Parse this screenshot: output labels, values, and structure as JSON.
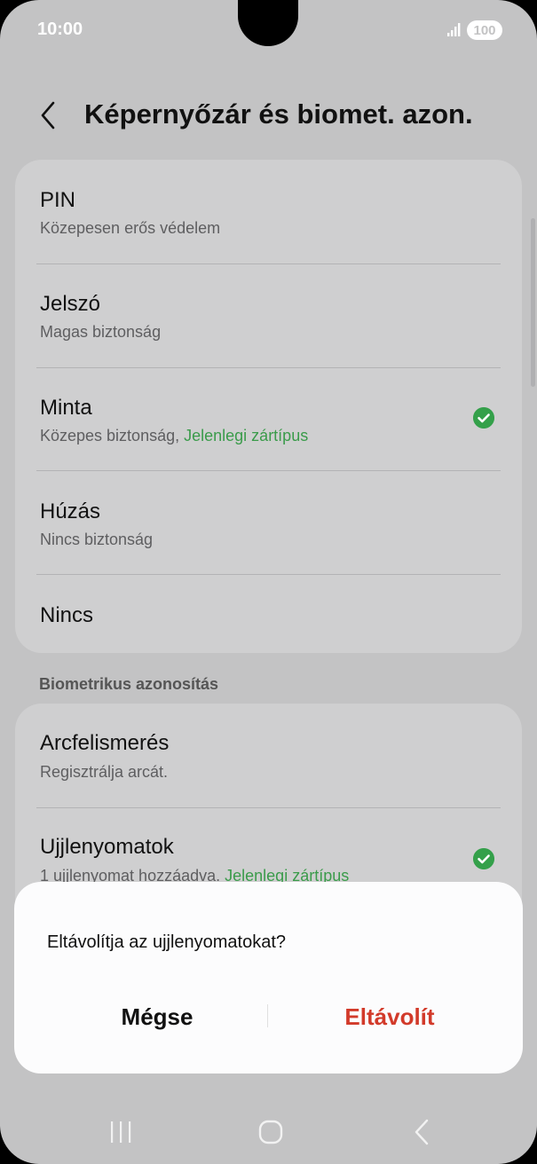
{
  "status_bar": {
    "time": "10:00",
    "battery": "100",
    "icons": [
      "signal-icon",
      "battery-icon"
    ]
  },
  "header": {
    "back_icon": "chevron-left-icon",
    "title": "Képernyőzár és biomet. azon."
  },
  "lock_types": [
    {
      "title": "PIN",
      "subtitle": "Közepesen erős védelem"
    },
    {
      "title": "Jelszó",
      "subtitle": "Magas biztonság"
    },
    {
      "title": "Minta",
      "subtitle": "Közepes biztonság,",
      "status": "Jelenlegi zártípus",
      "selected": true
    },
    {
      "title": "Húzás",
      "subtitle": "Nincs biztonság"
    },
    {
      "title": "Nincs"
    }
  ],
  "biometrics": {
    "section_label": "Biometrikus azonosítás",
    "items": [
      {
        "title": "Arcfelismerés",
        "subtitle": "Regisztrálja arcát."
      },
      {
        "title": "Ujjlenyomatok",
        "subtitle": "1 ujjlenyomat hozzáadva.",
        "status": "Jelenlegi zártípus",
        "selected": true
      }
    ]
  },
  "dialog": {
    "message": "Eltávolítja az ujjlenyomatokat?",
    "cancel_label": "Mégse",
    "confirm_label": "Eltávolít"
  },
  "nav_bar": {
    "icons": [
      "recents-icon",
      "home-icon",
      "back-icon"
    ]
  },
  "colors": {
    "accent_green": "#34a04a",
    "destructive_red": "#d23a2a",
    "dim_background": "#c3c3c4"
  }
}
